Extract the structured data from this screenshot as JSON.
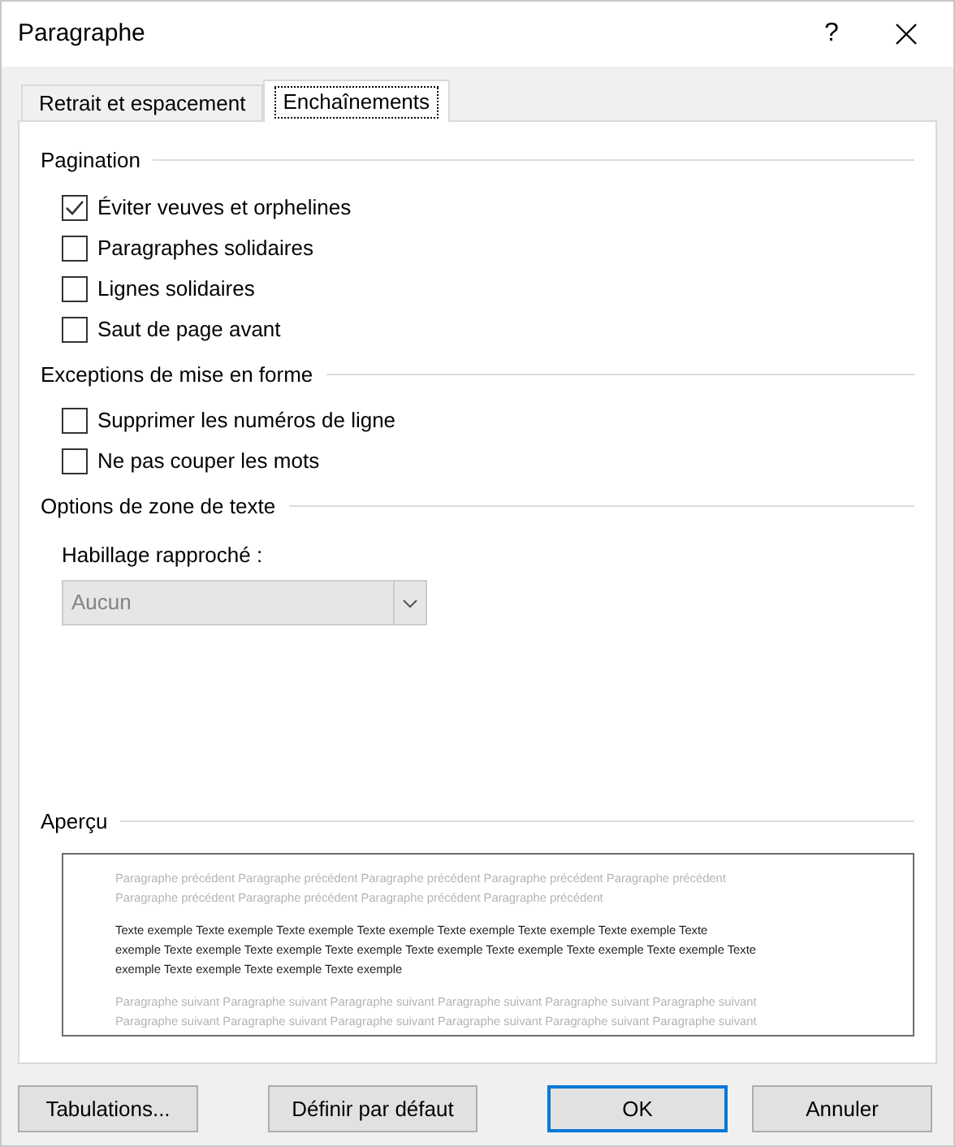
{
  "window": {
    "title": "Paragraphe",
    "help": "?"
  },
  "tabs": [
    {
      "label": "Retrait et espacement",
      "selected": false
    },
    {
      "label": "Enchaînements",
      "selected": true
    }
  ],
  "sections": [
    {
      "title": "Pagination",
      "options": [
        {
          "label": "Éviter veuves et orphelines",
          "checked": true
        },
        {
          "label": "Paragraphes solidaires",
          "checked": false
        },
        {
          "label": "Lignes solidaires",
          "checked": false
        },
        {
          "label": "Saut de page avant",
          "checked": false
        }
      ]
    },
    {
      "title": "Exceptions de mise en forme",
      "options": [
        {
          "label": "Supprimer les numéros de ligne",
          "checked": false
        },
        {
          "label": "Ne pas couper les mots",
          "checked": false
        }
      ]
    },
    {
      "title": "Options de zone de texte",
      "dropdown": {
        "label": "Habillage rapproché :",
        "value": "Aucun",
        "disabled": true
      }
    }
  ],
  "preview": {
    "title": "Aperçu",
    "paragraphs": [
      {
        "kind": "previous",
        "lines": [
          "Paragraphe précédent Paragraphe précédent Paragraphe précédent Paragraphe précédent Paragraphe précédent",
          "Paragraphe précédent Paragraphe précédent Paragraphe précédent Paragraphe précédent"
        ]
      },
      {
        "kind": "sample",
        "lines": [
          "Texte exemple Texte exemple Texte exemple Texte exemple Texte exemple Texte exemple Texte exemple Texte",
          "exemple Texte exemple Texte exemple Texte exemple Texte exemple Texte exemple Texte exemple Texte exemple Texte",
          "exemple Texte exemple Texte exemple Texte exemple"
        ]
      },
      {
        "kind": "next",
        "lines": [
          "Paragraphe suivant Paragraphe suivant Paragraphe suivant Paragraphe suivant Paragraphe suivant Paragraphe suivant",
          "Paragraphe suivant Paragraphe suivant Paragraphe suivant Paragraphe suivant Paragraphe suivant Paragraphe suivant"
        ]
      }
    ]
  },
  "buttons": [
    {
      "label": "Tabulations...",
      "default": false
    },
    {
      "label": "Définir par défaut",
      "default": false
    },
    {
      "label": "OK",
      "default": true
    },
    {
      "label": "Annuler",
      "default": false
    }
  ]
}
